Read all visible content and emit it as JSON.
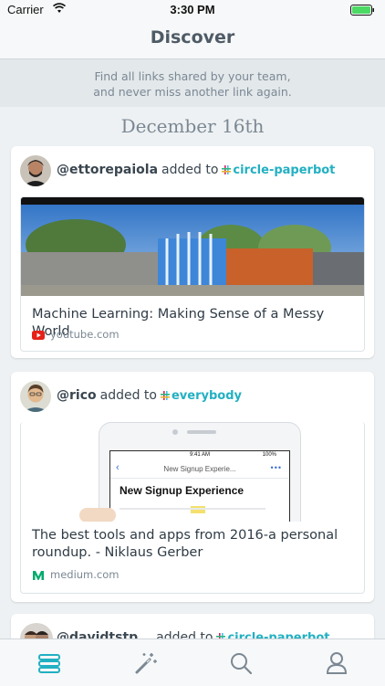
{
  "status_bar": {
    "carrier": "Carrier",
    "time": "3:30 PM"
  },
  "nav": {
    "title": "Discover"
  },
  "banner": {
    "line1": "Find all links shared by your team,",
    "line2": "and never miss another link again."
  },
  "date_header": "December 16th",
  "colors": {
    "accent": "#22b0c2",
    "youtube_red": "#e62117",
    "medium_green": "#00ab6c"
  },
  "posts": [
    {
      "username": "@ettorepaiola",
      "action": "added to",
      "channel": "circle-paperbot",
      "link_title": "Machine Learning: Making Sense of a Messy World",
      "domain": "youtube.com",
      "domain_icon": "youtube-icon"
    },
    {
      "username": "@rico",
      "action": "added to",
      "channel": "everybody",
      "link_title": "The best tools and apps from 2016-a personal roundup. - Niklaus Gerber",
      "domain": "medium.com",
      "domain_icon": "medium-icon",
      "preview": {
        "time": "9:41 AM",
        "battery": "100%",
        "nav_title": "New Signup Experie...",
        "heading": "New Signup Experience"
      }
    },
    {
      "username": "@davidtstp...",
      "action": "added to",
      "channel": "circle-paperbot"
    }
  ],
  "tabs": [
    {
      "name": "feed",
      "icon": "list-icon",
      "active": true
    },
    {
      "name": "discover",
      "icon": "magic-wand-icon",
      "active": false
    },
    {
      "name": "search",
      "icon": "search-icon",
      "active": false
    },
    {
      "name": "profile",
      "icon": "user-icon",
      "active": false
    }
  ]
}
